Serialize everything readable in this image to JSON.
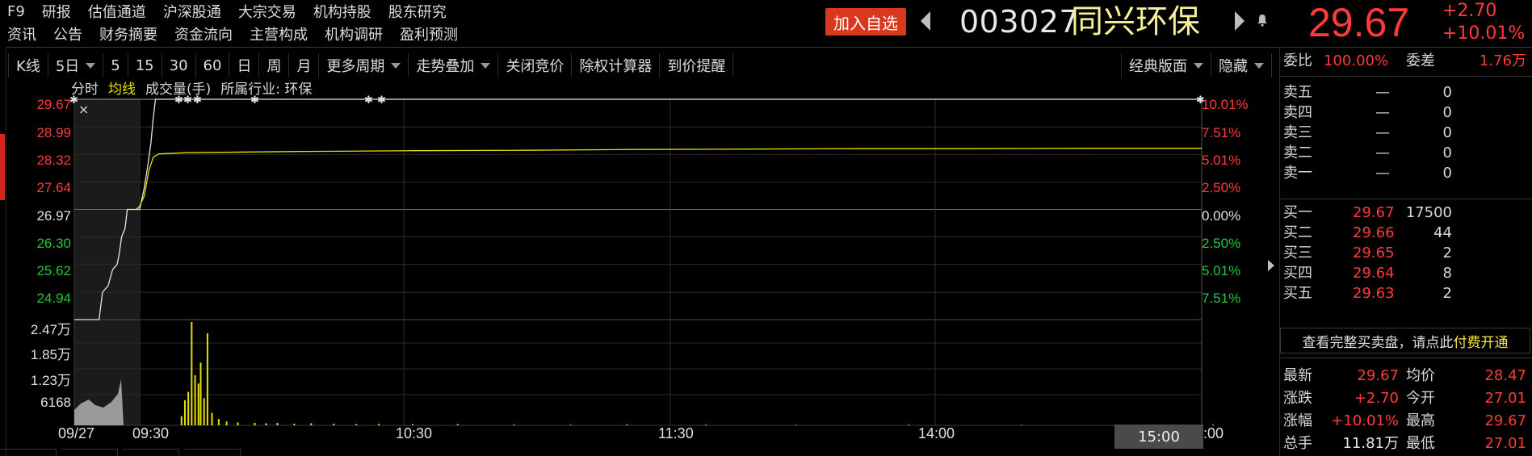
{
  "nav": {
    "row1": [
      "F9",
      "研报",
      "估值通道",
      "沪深股通",
      "大宗交易",
      "机构持股",
      "股东研究"
    ],
    "row2": [
      "资讯",
      "公告",
      "财务摘要",
      "资金流向",
      "主营构成",
      "机构调研",
      "盈利预测"
    ]
  },
  "header": {
    "add_watchlist": "加入自选",
    "code": "003027",
    "name": "同兴环保",
    "price": "29.67",
    "change": "+2.70",
    "change_pct": "+10.01%"
  },
  "toolbar": {
    "items": [
      "K线",
      "5日",
      "5",
      "15",
      "30",
      "60",
      "日",
      "周",
      "月",
      "更多周期",
      "走势叠加",
      "关闭竞价",
      "除权计算器",
      "到价提醒"
    ],
    "dropdowns": [
      "5日",
      "更多周期",
      "走势叠加"
    ],
    "classic_layout": "经典版面",
    "hide": "隐藏"
  },
  "chart_tabs": {
    "fenshi": "分时",
    "junxian": "均线",
    "volume": "成交量(手)",
    "industry": "所属行业: 环保"
  },
  "chart_data": {
    "type": "line",
    "title": "",
    "price_axis_left": [
      "29.67",
      "28.99",
      "28.32",
      "27.64",
      "26.97",
      "26.30",
      "25.62",
      "24.94"
    ],
    "pct_axis_right": [
      "10.01%",
      "7.51%",
      "5.01%",
      "2.50%",
      "0.00%",
      "2.50%",
      "5.01%",
      "7.51%"
    ],
    "volume_axis": [
      "2.47万",
      "1.85万",
      "1.23万",
      "6168"
    ],
    "x_ticks": [
      "09/27",
      "09:30",
      "10:30",
      "11:30",
      "14:00",
      "15:00"
    ],
    "x_tick_suffix": ":00",
    "prev_close": 26.97,
    "limit_up": 29.67,
    "ylim": [
      24.27,
      29.67
    ],
    "series": [
      {
        "name": "分时",
        "color": "#e6e6e6",
        "points": [
          [
            0,
            24.27
          ],
          [
            0.022,
            24.27
          ],
          [
            0.025,
            24.94
          ],
          [
            0.03,
            25.1
          ],
          [
            0.034,
            25.5
          ],
          [
            0.038,
            25.62
          ],
          [
            0.04,
            25.9
          ],
          [
            0.042,
            26.3
          ],
          [
            0.045,
            26.5
          ],
          [
            0.047,
            26.97
          ],
          [
            0.055,
            26.97
          ],
          [
            0.058,
            26.97
          ],
          [
            0.062,
            27.5
          ],
          [
            0.065,
            28.0
          ],
          [
            0.068,
            28.6
          ],
          [
            0.07,
            29.2
          ],
          [
            0.072,
            29.67
          ],
          [
            1.0,
            29.67
          ]
        ]
      },
      {
        "name": "均线",
        "color": "#e8e000",
        "points": [
          [
            0.055,
            26.97
          ],
          [
            0.058,
            27.05
          ],
          [
            0.062,
            27.3
          ],
          [
            0.066,
            27.9
          ],
          [
            0.07,
            28.25
          ],
          [
            0.075,
            28.33
          ],
          [
            0.1,
            28.36
          ],
          [
            0.2,
            28.39
          ],
          [
            0.3,
            28.41
          ],
          [
            0.4,
            28.42
          ],
          [
            0.5,
            28.44
          ],
          [
            0.6,
            28.45
          ],
          [
            0.7,
            28.46
          ],
          [
            0.8,
            28.46
          ],
          [
            0.9,
            28.47
          ],
          [
            1.0,
            28.47
          ]
        ]
      }
    ],
    "volume_max": 24700,
    "volume_bars": [
      [
        0.055,
        2200
      ],
      [
        0.058,
        6000
      ],
      [
        0.061,
        8000
      ],
      [
        0.064,
        24700
      ],
      [
        0.067,
        12000
      ],
      [
        0.07,
        10000
      ],
      [
        0.072,
        15000
      ],
      [
        0.075,
        6500
      ],
      [
        0.078,
        22000
      ],
      [
        0.082,
        3000
      ],
      [
        0.088,
        1500
      ],
      [
        0.095,
        900
      ],
      [
        0.105,
        700
      ],
      [
        0.12,
        600
      ],
      [
        0.13,
        500
      ],
      [
        0.14,
        600
      ],
      [
        0.155,
        400
      ],
      [
        0.17,
        500
      ],
      [
        0.19,
        400
      ],
      [
        0.21,
        300
      ],
      [
        0.23,
        350
      ],
      [
        0.26,
        250
      ],
      [
        0.3,
        300
      ],
      [
        0.35,
        200
      ],
      [
        0.4,
        150
      ],
      [
        0.45,
        200
      ],
      [
        0.52,
        150
      ],
      [
        0.6,
        120
      ],
      [
        0.7,
        150
      ],
      [
        0.8,
        100
      ],
      [
        0.9,
        120
      ],
      [
        0.97,
        200
      ]
    ]
  },
  "panel": {
    "weibi_label": "委比",
    "weibi": "100.00%",
    "weicha_label": "委差",
    "weicha": "1.76万",
    "sell": [
      {
        "label": "卖五",
        "price": "—",
        "vol": "0"
      },
      {
        "label": "卖四",
        "price": "—",
        "vol": "0"
      },
      {
        "label": "卖三",
        "price": "—",
        "vol": "0"
      },
      {
        "label": "卖二",
        "price": "—",
        "vol": "0"
      },
      {
        "label": "卖一",
        "price": "—",
        "vol": "0"
      }
    ],
    "buy": [
      {
        "label": "买一",
        "price": "29.67",
        "vol": "17500"
      },
      {
        "label": "买二",
        "price": "29.66",
        "vol": "44"
      },
      {
        "label": "买三",
        "price": "29.65",
        "vol": "2"
      },
      {
        "label": "买四",
        "price": "29.64",
        "vol": "8"
      },
      {
        "label": "买五",
        "price": "29.63",
        "vol": "2"
      }
    ],
    "full_book_text": "查看完整买卖盘，请点此",
    "paid_link": "付费开通",
    "stats": [
      {
        "l1": "最新",
        "v1": "29.67",
        "l2": "均价",
        "v2": "28.47"
      },
      {
        "l1": "涨跌",
        "v1": "+2.70",
        "l2": "今开",
        "v2": "27.01"
      },
      {
        "l1": "涨幅",
        "v1": "+10.01%",
        "l2": "最高",
        "v2": "29.67"
      },
      {
        "l1": "总手",
        "v1": "11.81万",
        "v1b": "万",
        "l2": "最低",
        "v2": "27.01"
      }
    ]
  },
  "colors": {
    "up": "#ff3a3a",
    "down": "#27c43a",
    "accent_yellow": "#e8e000",
    "brand_button": "#d9381e"
  }
}
